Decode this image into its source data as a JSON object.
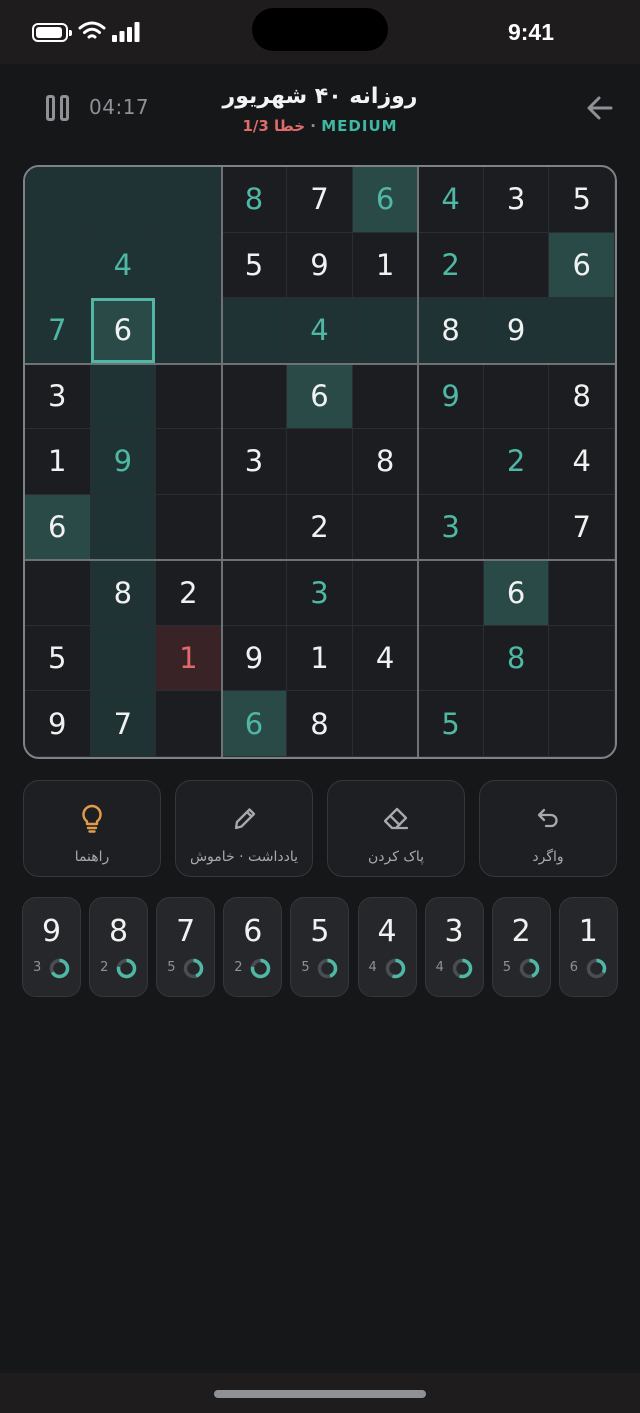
{
  "status_bar": {
    "time": "9:41"
  },
  "header": {
    "timer": "04:17",
    "title": "روزانه ۴۰ شهریور",
    "mistakes": "خطا 1/3",
    "separator": " · ",
    "difficulty": "MEDIUM"
  },
  "board": {
    "rows": [
      [
        "",
        "",
        "",
        "8",
        "7",
        "6",
        "4",
        "3",
        "5"
      ],
      [
        "",
        "4",
        "",
        "5",
        "9",
        "1",
        "2",
        "",
        "6"
      ],
      [
        "7",
        "6",
        "",
        "",
        "4",
        "",
        "8",
        "9",
        ""
      ],
      [
        "3",
        "",
        "",
        "",
        "6",
        "",
        "9",
        "",
        "8"
      ],
      [
        "1",
        "9",
        "",
        "3",
        "",
        "8",
        "",
        "2",
        "4"
      ],
      [
        "6",
        "",
        "",
        "",
        "2",
        "",
        "3",
        "",
        "7"
      ],
      [
        "",
        "8",
        "2",
        "",
        "3",
        "",
        "",
        "6",
        ""
      ],
      [
        "5",
        "",
        "1",
        "9",
        "1",
        "4",
        "",
        "8",
        ""
      ],
      [
        "9",
        "7",
        "",
        "6",
        "8",
        "",
        "5",
        "",
        ""
      ]
    ],
    "user_cells": [
      "0,3",
      "0,5",
      "0,6",
      "1,1",
      "1,6",
      "2,0",
      "2,4",
      "3,6",
      "4,1",
      "4,7",
      "5,6",
      "6,4",
      "7,2",
      "7,7",
      "8,3",
      "8,6"
    ],
    "error_cells": [
      "7,2"
    ],
    "selected_cell": "2,1",
    "selected_value": "6"
  },
  "actions": [
    {
      "key": "hint",
      "label": "راهنما",
      "icon": "lightbulb-icon",
      "color": "#E39A4B"
    },
    {
      "key": "notes",
      "label": "یادداشت · خاموش",
      "icon": "pencil-icon",
      "color": "#A6A9AE"
    },
    {
      "key": "erase",
      "label": "پاک کردن",
      "icon": "eraser-icon",
      "color": "#A6A9AE"
    },
    {
      "key": "undo",
      "label": "واگرد",
      "icon": "undo-icon",
      "color": "#A6A9AE"
    }
  ],
  "number_pad": [
    {
      "digit": "9",
      "remaining": "3"
    },
    {
      "digit": "8",
      "remaining": "2"
    },
    {
      "digit": "7",
      "remaining": "5"
    },
    {
      "digit": "6",
      "remaining": "2"
    },
    {
      "digit": "5",
      "remaining": "5"
    },
    {
      "digit": "4",
      "remaining": "4"
    },
    {
      "digit": "3",
      "remaining": "4"
    },
    {
      "digit": "2",
      "remaining": "5"
    },
    {
      "digit": "1",
      "remaining": "6"
    }
  ],
  "colors": {
    "accent": "#4FB8A5",
    "error": "#E06B6B",
    "hint": "#E39A4B"
  }
}
